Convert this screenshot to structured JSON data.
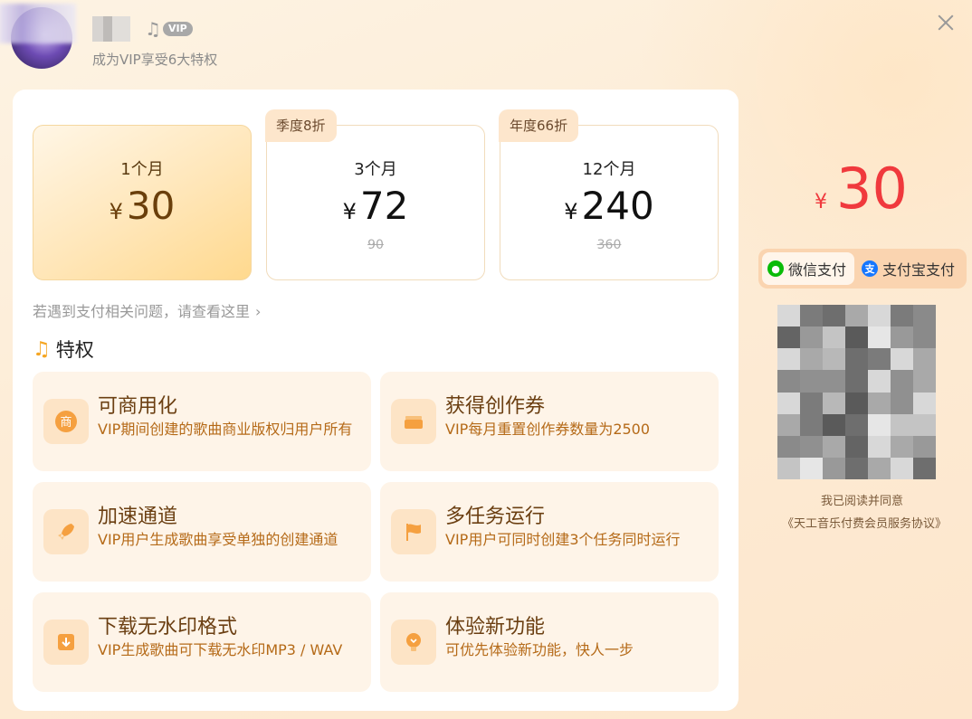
{
  "header": {
    "vip_badge": "VIP",
    "subtitle": "成为VIP享受6大特权"
  },
  "plans": [
    {
      "name": "1个月",
      "currency": "¥",
      "price": "30",
      "original": "",
      "tag": "",
      "selected": true
    },
    {
      "name": "3个月",
      "currency": "¥",
      "price": "72",
      "original": "90",
      "tag": "季度8折",
      "selected": false
    },
    {
      "name": "12个月",
      "currency": "¥",
      "price": "240",
      "original": "360",
      "tag": "年度66折",
      "selected": false
    }
  ],
  "help_link": "若遇到支付相关问题，请查看这里",
  "privileges_title": "特权",
  "features": [
    {
      "icon": "shop-icon",
      "title": "可商用化",
      "desc": "VIP期间创建的歌曲商业版权归用户所有"
    },
    {
      "icon": "ticket-icon",
      "title": "获得创作券",
      "desc": "VIP每月重置创作券数量为2500"
    },
    {
      "icon": "rocket-icon",
      "title": "加速通道",
      "desc": "VIP用户生成歌曲享受单独的创建通道"
    },
    {
      "icon": "flag-icon",
      "title": "多任务运行",
      "desc": "VIP用户可同时创建3个任务同时运行"
    },
    {
      "icon": "download-icon",
      "title": "下载无水印格式",
      "desc": "VIP生成歌曲可下载无水印MP3 / WAV"
    },
    {
      "icon": "lightbulb-icon",
      "title": "体验新功能",
      "desc": "可优先体验新功能，快人一步"
    }
  ],
  "payment": {
    "currency": "¥",
    "amount": "30",
    "methods": [
      {
        "label": "微信支付",
        "icon": "wechat-icon",
        "active": true
      },
      {
        "label": "支付宝支付",
        "icon": "alipay-icon",
        "active": false
      }
    ],
    "agree_text": "我已阅读并同意",
    "agreement_link": "《天工音乐付费会员服务协议》"
  },
  "colors": {
    "accent_orange": "#b56a18",
    "price_red": "#f0393d",
    "wechat_green": "#09bb07",
    "alipay_blue": "#1677ff"
  }
}
